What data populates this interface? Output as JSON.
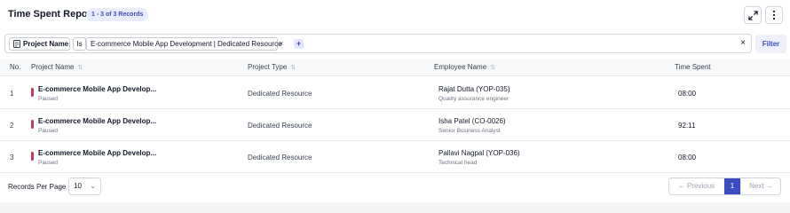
{
  "header": {
    "title": "Time Spent Report",
    "record_count": "1 - 3 of 3 Records",
    "expand_icon": "expand-icon",
    "more_icon": "more-vertical-icon"
  },
  "filter": {
    "field_label": "Project Name",
    "operator": "Is",
    "value": "E-commerce Mobile App Development | Dedicated Resource",
    "remove_symbol": "×",
    "add_symbol": "+",
    "clear_symbol": "×",
    "button_label": "Filter"
  },
  "table": {
    "columns": [
      "No.",
      "Project Name",
      "Project Type",
      "Employee Name",
      "Time Spent"
    ],
    "rows": [
      {
        "no": "1",
        "project": "E-commerce Mobile App Develop...",
        "status": "Paused",
        "type": "Dedicated Resource",
        "employee": "Rajat Dutta (YOP-035)",
        "role": "Quality assurance engineer",
        "time": "08:00"
      },
      {
        "no": "2",
        "project": "E-commerce Mobile App Develop...",
        "status": "Paused",
        "type": "Dedicated Resource",
        "employee": "Isha Patel (CO-0026)",
        "role": "Senior Business Analyst",
        "time": "92:11"
      },
      {
        "no": "3",
        "project": "E-commerce Mobile App Develop...",
        "status": "Paused",
        "type": "Dedicated Resource",
        "employee": "Pallavi Nagpal (YOP-036)",
        "role": "Technical head",
        "time": "08:00"
      }
    ]
  },
  "footer": {
    "records_per_page_label": "Records Per Page",
    "records_per_page_value": "10",
    "previous_label": "Previous",
    "current_page": "1",
    "next_label": "Next"
  },
  "colors": {
    "accent": "#3b4cc0",
    "status_marker": "#c0395f"
  }
}
